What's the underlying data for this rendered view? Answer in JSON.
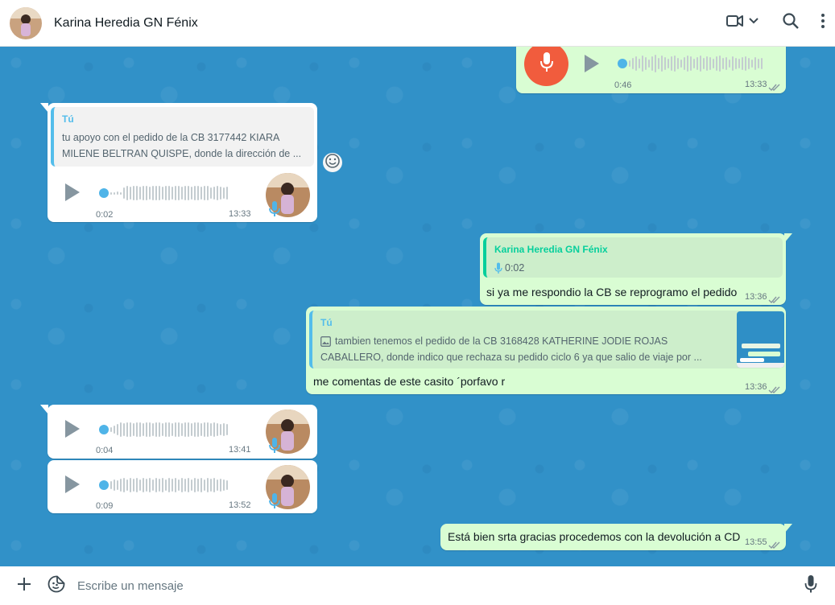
{
  "contact": {
    "name": "Karina Heredia GN Fénix"
  },
  "composer": {
    "placeholder": "Escribe un mensaje"
  },
  "messages": [
    {
      "type": "voice-out",
      "duration": "0:46",
      "time": "13:33"
    },
    {
      "type": "voice-in",
      "quote_sender": "Tú",
      "quote_text_line1": "tu apoyo con el pedido de la CB 3177442 KIARA",
      "quote_text_line2": "MILENE BELTRAN QUISPE, donde la dirección de ...",
      "duration": "0:02",
      "time": "13:33"
    },
    {
      "type": "text-out",
      "quote_sender": "Karina Heredia GN Fénix",
      "quote_duration": "0:02",
      "text": "si ya me respondio la CB se reprogramo el pedido",
      "time": "13:36"
    },
    {
      "type": "text-out",
      "quote_sender": "Tú",
      "quote_text_line1": "tambien tenemos el pedido de la CB 3168428 KATHERINE JODIE ROJAS",
      "quote_text_line2": "CABALLERO, donde indico que rechaza su pedido ciclo 6 ya que salio de viaje por ...",
      "text": "me comentas de este casito ´porfavo r",
      "time": "13:36"
    },
    {
      "type": "voice-in",
      "duration": "0:04",
      "time": "13:41"
    },
    {
      "type": "voice-in",
      "duration": "0:09",
      "time": "13:52"
    },
    {
      "type": "text-out",
      "text": "Está bien srta gracias procedemos con la devolución a CD",
      "time": "13:55"
    }
  ],
  "icons": [
    "video-call-icon",
    "chevron-down-icon",
    "search-icon",
    "menu-icon",
    "plus-icon",
    "sticker-icon",
    "mic-icon",
    "play-icon",
    "double-check-icon",
    "emoji-icon",
    "image-icon"
  ]
}
